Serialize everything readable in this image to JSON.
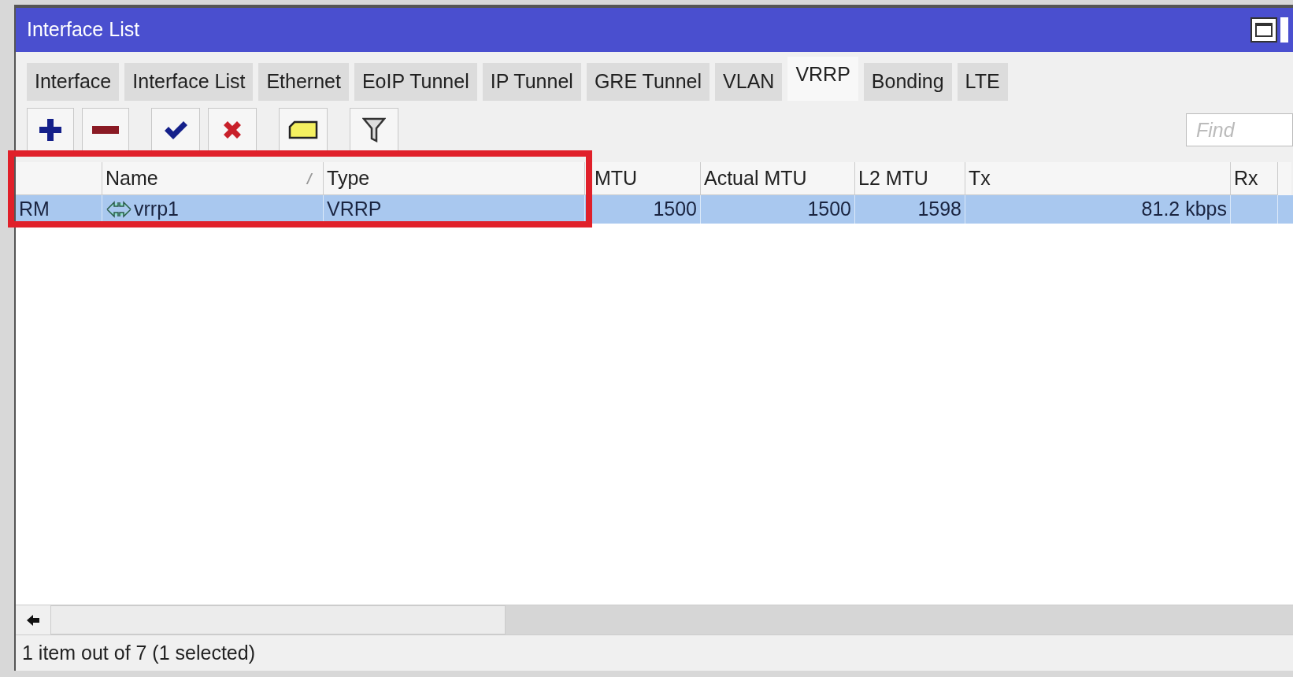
{
  "window": {
    "title": "Interface List"
  },
  "tabs": [
    {
      "label": "Interface",
      "selected": false
    },
    {
      "label": "Interface List",
      "selected": false
    },
    {
      "label": "Ethernet",
      "selected": false
    },
    {
      "label": "EoIP Tunnel",
      "selected": false
    },
    {
      "label": "IP Tunnel",
      "selected": false
    },
    {
      "label": "GRE Tunnel",
      "selected": false
    },
    {
      "label": "VLAN",
      "selected": false
    },
    {
      "label": "VRRP",
      "selected": true
    },
    {
      "label": "Bonding",
      "selected": false
    },
    {
      "label": "LTE",
      "selected": false
    }
  ],
  "find": {
    "placeholder": "Find"
  },
  "table": {
    "columns": [
      {},
      {
        "label": "Name",
        "sorted": true
      },
      {
        "label": "Type"
      },
      {
        "label": "MTU"
      },
      {
        "label": "Actual MTU"
      },
      {
        "label": "L2 MTU"
      },
      {
        "label": "Tx"
      },
      {
        "label": "Rx"
      }
    ],
    "rows": [
      {
        "selected": true,
        "cells": [
          "RM",
          "vrrp1",
          "VRRP",
          "1500",
          "1500",
          "1598",
          "81.2 kbps"
        ]
      }
    ]
  },
  "status_bar": "1 item out of 7 (1 selected)"
}
